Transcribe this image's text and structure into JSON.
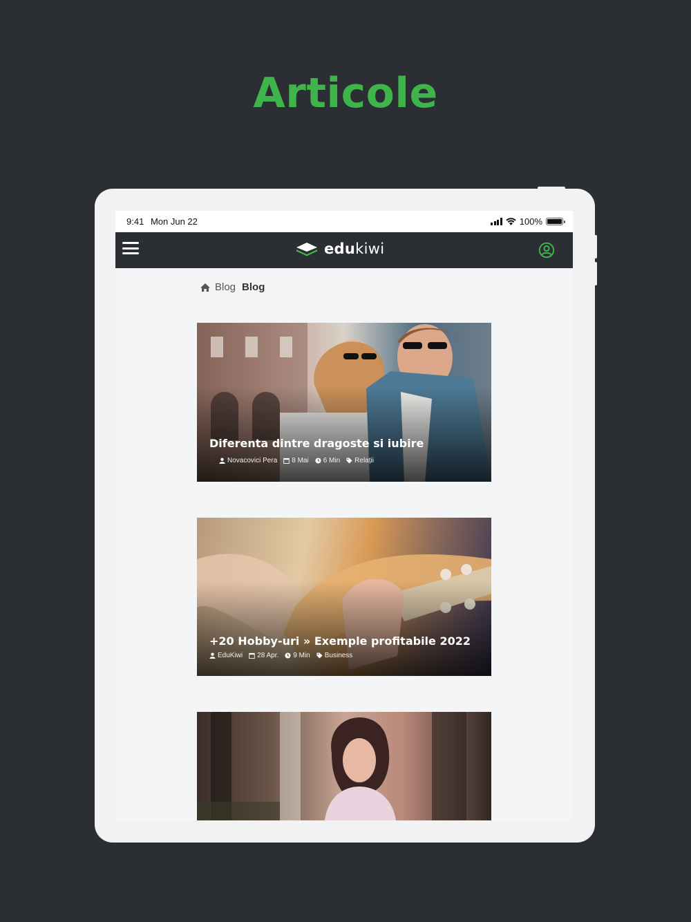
{
  "promo": {
    "title": "Articole"
  },
  "status_bar": {
    "time": "9:41",
    "date": "Mon Jun 22",
    "battery": "100%"
  },
  "header": {
    "logo_bold": "edu",
    "logo_light": "kiwi"
  },
  "breadcrumb": {
    "parent": "Blog",
    "current": "Blog"
  },
  "articles": [
    {
      "title": "Diferenta dintre dragoste si iubire",
      "author": "Novacovici Pera",
      "date": "8 Mai",
      "read_time": "6 Min",
      "category": "Relații"
    },
    {
      "title": "+20 Hobby-uri » Exemple profitabile 2022",
      "author": "EduKiwi",
      "date": "28 Apr.",
      "read_time": "9 Min",
      "category": "Business"
    }
  ],
  "colors": {
    "accent": "#3fb44a",
    "background": "#2b2e33",
    "navbar": "#2b2e33",
    "screen": "#f4f5f7"
  },
  "icons": {
    "menu": "hamburger-icon",
    "account": "account-icon",
    "home": "home-icon",
    "user": "user-icon",
    "calendar": "calendar-icon",
    "clock": "clock-icon",
    "tag": "tag-icon"
  }
}
